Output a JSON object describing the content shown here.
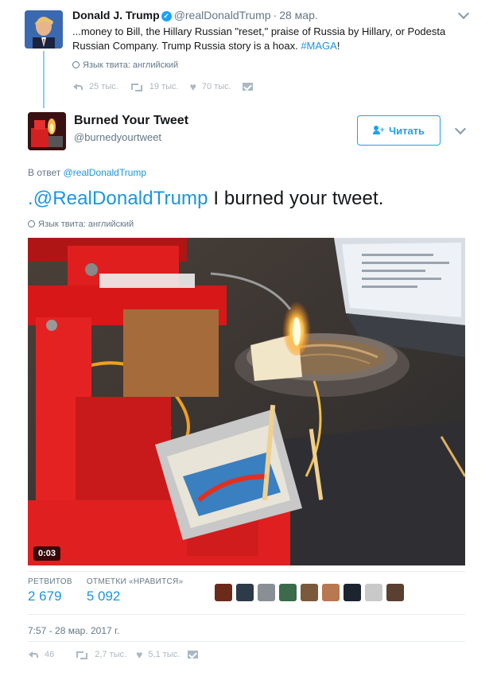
{
  "parent_tweet": {
    "author_name": "Donald J. Trump",
    "verified_mark": "✓",
    "handle": "@realDonaldTrump",
    "separator": "·",
    "date": "28 мар.",
    "text_before": "...money to Bill, the Hillary Russian \"reset,\" praise of Russia by Hillary, or Podesta Russian Company. Trump Russia story is a hoax. ",
    "hashtag": "#MAGA",
    "text_after": "!",
    "language_note": "Язык твита: английский",
    "replies": "25 тыс.",
    "retweets": "19 тыс.",
    "likes": "70 тыс."
  },
  "main_tweet": {
    "author_name": "Burned Your Tweet",
    "handle": "@burnedyourtweet",
    "follow_label": "Читать",
    "reply_prefix": "В ответ",
    "reply_to": "@realDonaldTrump",
    "text_mention": ".@RealDonaldTrump",
    "text_rest": " I burned your tweet.",
    "language_note": "Язык твита: английский",
    "video_duration": "0:03",
    "retweets_label": "РЕТВИТОВ",
    "retweets_count": "2 679",
    "likes_label": "ОТМЕТКИ «НРАВИТСЯ»",
    "likes_count": "5 092",
    "timestamp": "7:57 - 28 мар. 2017 г.",
    "reply_count": "46",
    "retweet_action_count": "2,7 тыс.",
    "like_action_count": "5,1 тыс."
  },
  "icons": {
    "globe": "globe-icon",
    "reply": "reply-icon",
    "retweet": "retweet-icon",
    "heart": "heart-icon",
    "direct_message": "envelope-icon",
    "caret": "chevron-down-icon",
    "follow": "add-user-icon"
  },
  "colors": {
    "link": "#1b95e0",
    "accent": "#1da1f2",
    "muted": "#657786",
    "action": "#aab8c2"
  },
  "liker_avatar_colors": [
    "#6b2a1a",
    "#2d3a4a",
    "#8a8f96",
    "#3b6b4a",
    "#7a5a3a",
    "#b87850",
    "#1c2430",
    "#c9c9c9",
    "#5a4030"
  ]
}
